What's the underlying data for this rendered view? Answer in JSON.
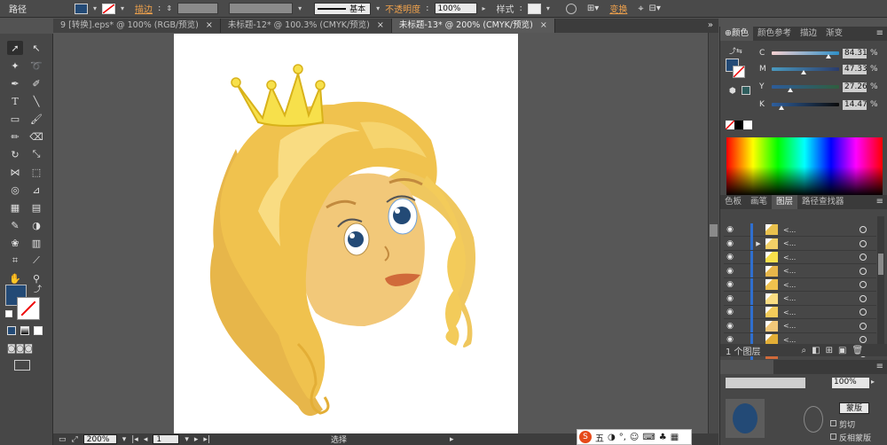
{
  "control_bar": {
    "object_type": "路径",
    "stroke_label": "描边",
    "stroke_style": "基本",
    "opacity_label": "不透明度",
    "opacity_value": "100%",
    "style_label": "样式",
    "transform_label": "变换",
    "fill_color": "#234a76"
  },
  "tabs": [
    {
      "label": "9 [转换].eps* @ 100% (RGB/预览)",
      "close": "×"
    },
    {
      "label": "未标题-12* @ 100.3% (CMYK/预览)",
      "close": "×"
    },
    {
      "label": "未标题-13* @ 200% (CMYK/预览)",
      "close": "×"
    }
  ],
  "status_bar": {
    "zoom": "200%",
    "page": "1",
    "tool": "选择"
  },
  "color_panel": {
    "tabs": [
      "颜色",
      "颜色参考",
      "描边",
      "渐变"
    ],
    "channels": [
      {
        "name": "C",
        "value": "84.31",
        "unit": "%",
        "pct": 84.31
      },
      {
        "name": "M",
        "value": "47.33",
        "unit": "%",
        "pct": 47.33
      },
      {
        "name": "Y",
        "value": "27.26",
        "unit": "%",
        "pct": 27.26
      },
      {
        "name": "K",
        "value": "14.47",
        "unit": "%",
        "pct": 14.47
      }
    ]
  },
  "layers_panel": {
    "tabs": [
      "色板",
      "画笔",
      "图层",
      "路径查找器"
    ],
    "item_name": "<...",
    "footer": "1 个图层",
    "rows": 10
  },
  "transparency_panel": {
    "opacity": "100%",
    "mask_button": "蒙版",
    "clip_label": "剪切",
    "invert_label": "反相蒙版"
  },
  "taskbar": {
    "ime_label": "五"
  },
  "colors": {
    "accent_orange": "#f0a24c",
    "layer_blue": "#2f6fcf",
    "fill_swatch": "#234a76"
  }
}
